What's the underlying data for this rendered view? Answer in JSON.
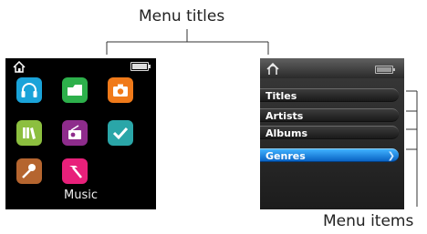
{
  "callouts": {
    "menu_titles": "Menu titles",
    "menu_items": "Menu items"
  },
  "left_screen": {
    "status": {
      "home_icon": "home-icon",
      "battery_icon": "battery-icon"
    },
    "apps": [
      {
        "name": "headphones-icon",
        "color": "#1aa3d9"
      },
      {
        "name": "folder-icon",
        "color": "#2db04b"
      },
      {
        "name": "camera-icon",
        "color": "#f07a1a"
      },
      {
        "name": "book-icon",
        "color": "#8cbf3f"
      },
      {
        "name": "radio-icon",
        "color": "#8e2c8c"
      },
      {
        "name": "check-icon",
        "color": "#2aa6a8"
      },
      {
        "name": "microphone-icon",
        "color": "#b5652f"
      },
      {
        "name": "tools-icon",
        "color": "#e8207a"
      }
    ],
    "caption": "Music"
  },
  "right_screen": {
    "status": {
      "home_icon": "home-icon",
      "battery_icon": "battery-icon"
    },
    "menu": [
      {
        "label": "Titles",
        "selected": false
      },
      {
        "label": "Artists",
        "selected": false
      },
      {
        "label": "Albums",
        "selected": false
      },
      {
        "label": "Genres",
        "selected": true
      }
    ],
    "selected_color": "#1e88e5"
  }
}
